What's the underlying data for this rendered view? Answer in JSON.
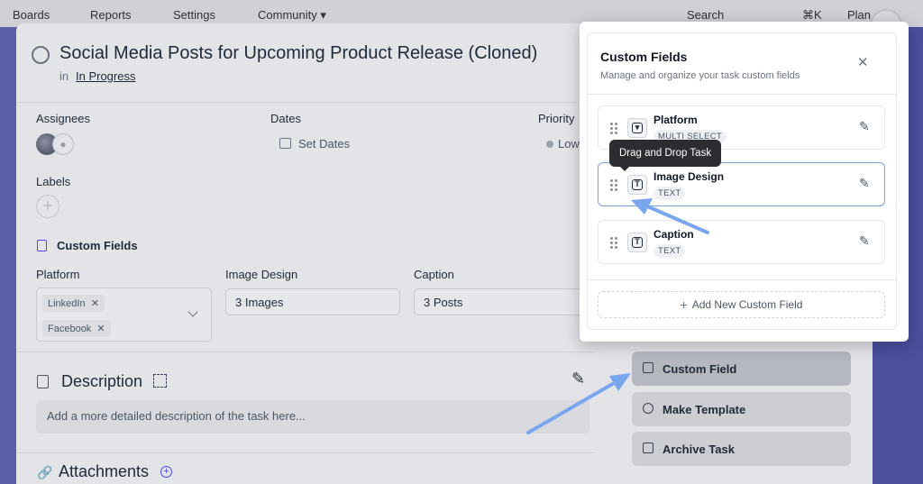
{
  "topbar": {
    "items": [
      "Boards",
      "Reports",
      "Settings",
      "Community ▾",
      "Search",
      "⌘K",
      "Plan"
    ]
  },
  "task": {
    "title": "Social Media Posts for Upcoming Product Release (Cloned)",
    "in_prefix": "in",
    "status_link": "In Progress",
    "assignees_label": "Assignees",
    "dates_label": "Dates",
    "set_dates": "Set Dates",
    "priority_label": "Priority",
    "priority_value": "Low",
    "labels_label": "Labels",
    "custom_fields_title": "Custom Fields",
    "fields": {
      "platform_label": "Platform",
      "platform_chips": [
        "LinkedIn",
        "Facebook"
      ],
      "image_label": "Image Design",
      "image_value": "3 Images",
      "caption_label": "Caption",
      "caption_value": "3 Posts"
    },
    "description_title": "Description",
    "description_placeholder": "Add a more detailed description of the task here...",
    "attachments_title": "Attachments"
  },
  "sidebar": {
    "custom_field": "Custom Field",
    "make_template": "Make Template",
    "archive_task": "Archive Task"
  },
  "popover": {
    "title": "Custom Fields",
    "subtitle": "Manage and organize your task custom fields",
    "items": [
      {
        "name": "Platform",
        "type": "MULTI SELECT",
        "icon": "select-icon"
      },
      {
        "name": "Image Design",
        "type": "TEXT",
        "icon": "text-type-icon"
      },
      {
        "name": "Caption",
        "type": "TEXT",
        "icon": "text-type-icon"
      }
    ],
    "add_button": "Add New Custom Field"
  },
  "tooltip": "Drag and Drop Task",
  "colors": {
    "accent": "#4f46e5",
    "highlight_border": "#7aa0e8",
    "annotation_arrow": "#7aa6f0"
  }
}
